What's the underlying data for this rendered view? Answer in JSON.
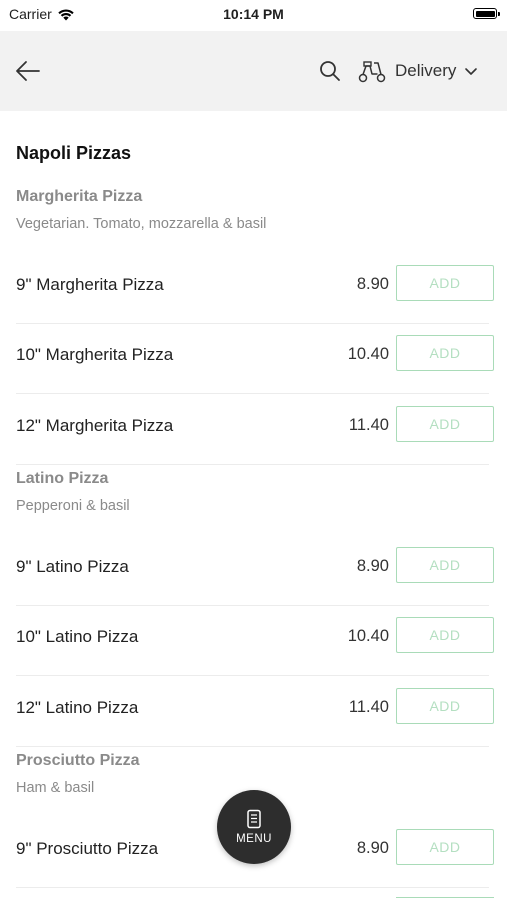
{
  "status_bar": {
    "carrier": "Carrier",
    "time": "10:14 PM",
    "battery_level": 1.0
  },
  "header": {
    "delivery_label": "Delivery"
  },
  "section_title": "Napoli Pizzas",
  "groups": [
    {
      "name": "Margherita Pizza",
      "description": "Vegetarian. Tomato, mozzarella & basil",
      "items": [
        {
          "name": "9\" Margherita Pizza",
          "price": "8.90",
          "add_label": "ADD"
        },
        {
          "name": "10\" Margherita Pizza",
          "price": "10.40",
          "add_label": "ADD"
        },
        {
          "name": "12\" Margherita Pizza",
          "price": "11.40",
          "add_label": "ADD"
        }
      ]
    },
    {
      "name": "Latino Pizza",
      "description": "Pepperoni & basil",
      "items": [
        {
          "name": "9\" Latino Pizza",
          "price": "8.90",
          "add_label": "ADD"
        },
        {
          "name": "10\" Latino Pizza",
          "price": "10.40",
          "add_label": "ADD"
        },
        {
          "name": "12\" Latino Pizza",
          "price": "11.40",
          "add_label": "ADD"
        }
      ]
    },
    {
      "name": "Prosciutto Pizza",
      "description": "Ham & basil",
      "items": [
        {
          "name": "9\" Prosciutto Pizza",
          "price": "8.90",
          "add_label": "ADD"
        }
      ]
    }
  ],
  "menu_button": {
    "label": "MENU"
  },
  "colors": {
    "accent": "#a9dbb8",
    "header_bg": "#f2f2f2",
    "fab_bg": "#2d2d2d"
  },
  "icons": {
    "back": "arrow-left-icon",
    "search": "search-icon",
    "delivery": "scooter-icon",
    "dropdown": "chevron-down-icon",
    "menu": "menu-icon"
  }
}
